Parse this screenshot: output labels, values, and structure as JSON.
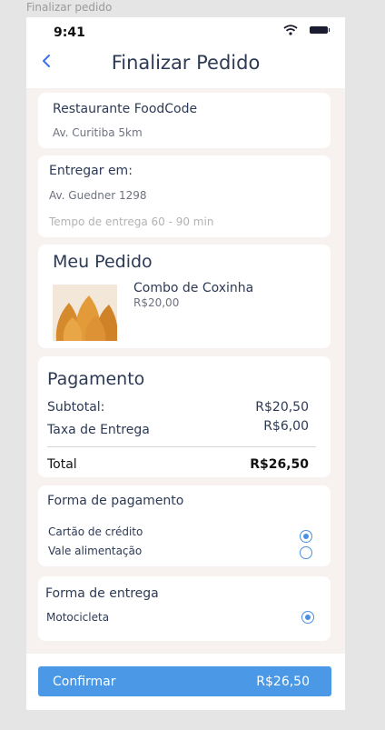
{
  "frame_label": "Finalizar pedido",
  "status_bar": {
    "time": "9:41",
    "icons": [
      "wifi-icon",
      "battery-icon"
    ]
  },
  "header": {
    "back_icon": "chevron-left-icon",
    "title": "Finalizar Pedido"
  },
  "restaurant": {
    "name": "Restaurante  FoodCode",
    "address": "Av. Curitiba 5km"
  },
  "delivery": {
    "label": "Entregar em:",
    "address": "Av. Guedner 1298",
    "time_text": "Tempo de entrega  60 - 90 min"
  },
  "order": {
    "title": "Meu Pedido",
    "item_name": "Combo de Coxinha",
    "item_price": "R$20,00",
    "item_image": "coxinha-photo"
  },
  "payment": {
    "title": "Pagamento",
    "subtotal_label": "Subtotal:",
    "subtotal_value": "R$20,50",
    "fee_label": "Taxa de Entrega",
    "fee_value": "R$6,00",
    "total_label": "Total",
    "total_value": "R$26,50"
  },
  "payment_method": {
    "title": "Forma de pagamento",
    "options": [
      {
        "label": "Cartão de crédito",
        "selected": true
      },
      {
        "label": "Vale alimentação",
        "selected": false
      }
    ]
  },
  "delivery_method": {
    "title": "Forma de entrega",
    "options": [
      {
        "label": "Motocicleta",
        "selected": true
      }
    ]
  },
  "confirm": {
    "label": "Confirmar",
    "total": "R$26,50"
  },
  "colors": {
    "accent": "#4a98e6",
    "title": "#2d3a55",
    "background": "#f7f1ef",
    "back_icon": "#3b6ff0"
  }
}
